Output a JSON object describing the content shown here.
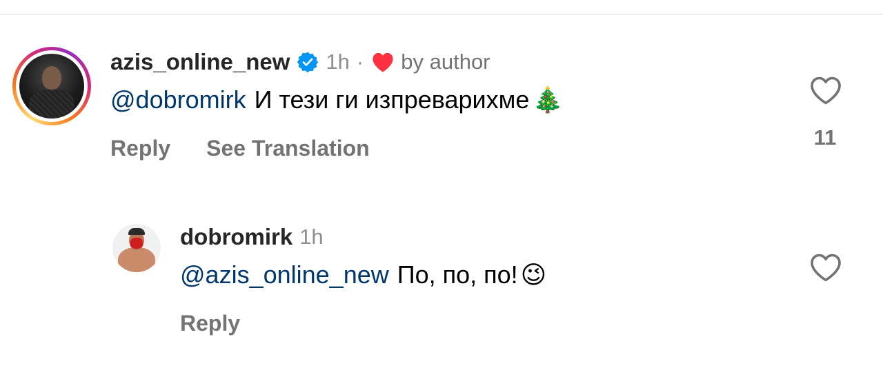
{
  "comments": [
    {
      "username": "azis_online_new",
      "verified": true,
      "time": "1h",
      "separator": "·",
      "liked_by_author_label": "by author",
      "mention": "@dobromirk",
      "text": "И тези ги изпреварихме",
      "emoji": "🎄",
      "actions": {
        "reply": "Reply",
        "translate": "See Translation"
      },
      "like_count": "11"
    },
    {
      "username": "dobromirk",
      "verified": false,
      "time": "1h",
      "mention": "@azis_online_new",
      "text": "По, по, по!",
      "emoji": "😉",
      "actions": {
        "reply": "Reply"
      }
    }
  ],
  "colors": {
    "username": "#262626",
    "mention": "#00376b",
    "secondary_text": "#737373",
    "verified_blue": "#0095f6",
    "heart_red": "#ff3040"
  },
  "icons": {
    "verified": "verified-badge-icon",
    "author_like": "heart-filled-icon",
    "like": "heart-outline-icon"
  }
}
